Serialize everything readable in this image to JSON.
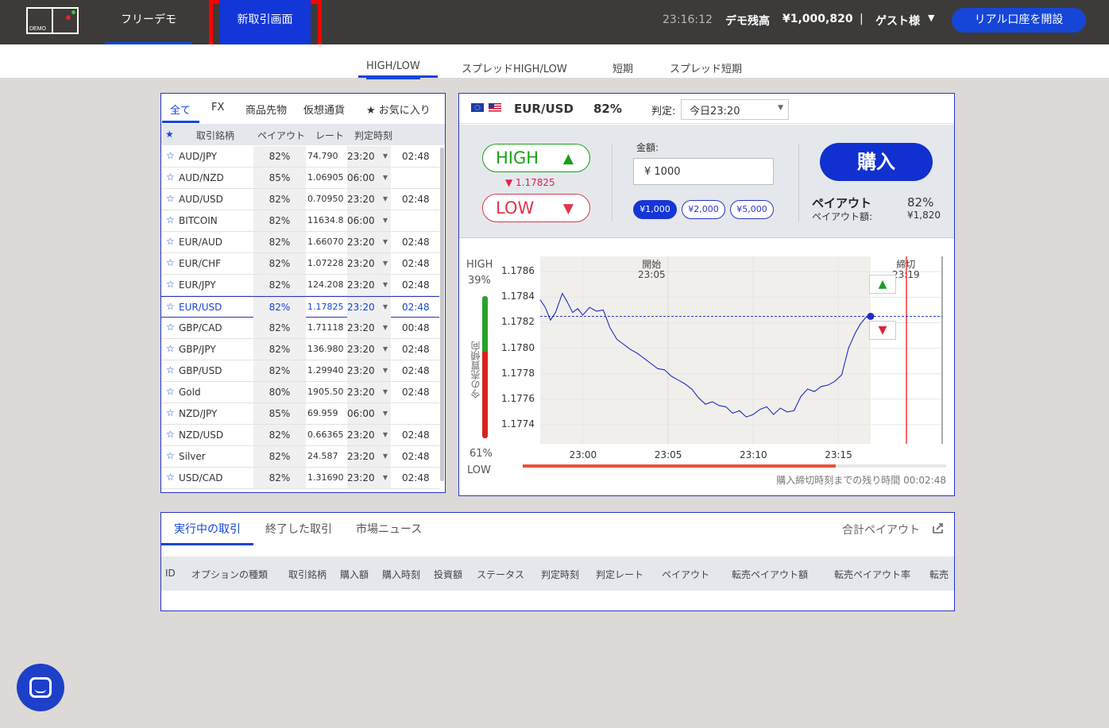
{
  "header": {
    "logo_text": "DEMO",
    "nav_free_demo": "フリーデモ",
    "nav_new_trade": "新取引画面",
    "clock": "23:16:12",
    "balance_label": "デモ残高",
    "balance_value": "¥1,000,820",
    "separator": "|",
    "user": "ゲスト様",
    "open_account": "リアル口座を開設"
  },
  "subnav": [
    "HIGH/LOW",
    "スプレッドHIGH/LOW",
    "短期",
    "スプレッド短期"
  ],
  "asset_filters": [
    "全て",
    "FX",
    "商品先物",
    "仮想通貨",
    "★ お気に入り"
  ],
  "asset_columns": {
    "star": "★",
    "name": "取引銘柄",
    "payout": "ペイアウト",
    "rate": "レート",
    "judge_time": "判定時刻"
  },
  "assets": [
    {
      "name": "AUD/JPY",
      "payout": "82%",
      "rate": "74.790",
      "time": "23:20",
      "remain": "02:48"
    },
    {
      "name": "AUD/NZD",
      "payout": "85%",
      "rate": "1.06905",
      "time": "06:00",
      "remain": ""
    },
    {
      "name": "AUD/USD",
      "payout": "82%",
      "rate": "0.70950",
      "time": "23:20",
      "remain": "02:48"
    },
    {
      "name": "BITCOIN",
      "payout": "82%",
      "rate": "11634.8",
      "time": "06:00",
      "remain": ""
    },
    {
      "name": "EUR/AUD",
      "payout": "82%",
      "rate": "1.66070",
      "time": "23:20",
      "remain": "02:48"
    },
    {
      "name": "EUR/CHF",
      "payout": "82%",
      "rate": "1.07228",
      "time": "23:20",
      "remain": "02:48"
    },
    {
      "name": "EUR/JPY",
      "payout": "82%",
      "rate": "124.208",
      "time": "23:20",
      "remain": "02:48"
    },
    {
      "name": "EUR/USD",
      "payout": "82%",
      "rate": "1.17825",
      "time": "23:20",
      "remain": "02:48"
    },
    {
      "name": "GBP/CAD",
      "payout": "82%",
      "rate": "1.71118",
      "time": "23:20",
      "remain": "00:48"
    },
    {
      "name": "GBP/JPY",
      "payout": "82%",
      "rate": "136.980",
      "time": "23:20",
      "remain": "02:48"
    },
    {
      "name": "GBP/USD",
      "payout": "82%",
      "rate": "1.29940",
      "time": "23:20",
      "remain": "02:48"
    },
    {
      "name": "Gold",
      "payout": "80%",
      "rate": "1905.50",
      "time": "23:20",
      "remain": "02:48"
    },
    {
      "name": "NZD/JPY",
      "payout": "85%",
      "rate": "69.959",
      "time": "06:00",
      "remain": ""
    },
    {
      "name": "NZD/USD",
      "payout": "82%",
      "rate": "0.66365",
      "time": "23:20",
      "remain": "02:48"
    },
    {
      "name": "Silver",
      "payout": "82%",
      "rate": "24.587",
      "time": "23:20",
      "remain": "02:48"
    },
    {
      "name": "USD/CAD",
      "payout": "82%",
      "rate": "1.31690",
      "time": "23:20",
      "remain": "02:48"
    }
  ],
  "selected_asset_index": 7,
  "trade": {
    "pair": "EUR/USD",
    "payout_pct": "82%",
    "judge_label": "判定:",
    "judge_value": "今日23:20",
    "high_label": "HIGH",
    "high_icon": "▲",
    "low_label": "LOW",
    "low_icon": "▼",
    "current_rate": "▼ 1.17825",
    "amount_label": "金額:",
    "amount_value": "¥ 1000",
    "chips": [
      "¥1,000",
      "¥2,000",
      "¥5,000"
    ],
    "buy_label": "購入",
    "payout_label": "ペイアウト",
    "payout_value": "82%",
    "payout_amount_label": "ペイアウト額:",
    "payout_amount_value": "¥1,820"
  },
  "sentiment": {
    "high_label": "HIGH",
    "high_pct": "39%",
    "low_pct": "61%",
    "low_label": "LOW",
    "caption": "今の売買傾向",
    "high_fraction": 0.39
  },
  "chart_data": {
    "type": "line",
    "y_ticks": [
      "1.1786",
      "1.1784",
      "1.1782",
      "1.1780",
      "1.1778",
      "1.1776",
      "1.1774"
    ],
    "x_ticks": [
      "23:00",
      "23:05",
      "23:10",
      "23:15"
    ],
    "ylim": [
      1.17725,
      1.17872
    ],
    "xlim_minutes": [
      -2.5,
      21.1
    ],
    "start_label": "開始",
    "start_time": "23:05",
    "end_label": "締切",
    "end_time": "23:19",
    "current_rate": 1.17825,
    "series": [
      {
        "x": [
          -2.5,
          -2.2,
          -1.9,
          -1.6,
          -1.2,
          -0.9,
          -0.6,
          -0.3,
          0,
          0.4,
          0.8,
          1.2,
          1.6,
          2,
          2.4,
          2.8,
          3.2,
          3.6,
          4,
          4.4,
          4.8,
          5.2,
          5.6,
          6,
          6.4,
          6.8,
          7.2,
          7.6,
          8,
          8.4,
          8.8,
          9.2,
          9.6,
          10,
          10.4,
          10.8,
          11.2,
          11.6,
          12,
          12.4,
          12.8,
          13.2,
          13.6,
          14,
          14.4,
          14.8,
          15.2,
          15.6,
          16,
          16.3,
          16.6,
          16.9
        ],
        "y": [
          1.17838,
          1.17832,
          1.17822,
          1.17828,
          1.17843,
          1.17836,
          1.17828,
          1.17831,
          1.17826,
          1.17832,
          1.17829,
          1.1783,
          1.17816,
          1.17807,
          1.17803,
          1.17799,
          1.17796,
          1.17792,
          1.17788,
          1.17784,
          1.17783,
          1.17778,
          1.17775,
          1.17772,
          1.17768,
          1.17761,
          1.17756,
          1.17758,
          1.17755,
          1.17754,
          1.17749,
          1.17751,
          1.17746,
          1.17748,
          1.17752,
          1.17754,
          1.17748,
          1.17753,
          1.1775,
          1.17751,
          1.17762,
          1.17768,
          1.17766,
          1.1777,
          1.17771,
          1.17774,
          1.17779,
          1.178,
          1.17812,
          1.17819,
          1.17824,
          1.17825
        ]
      }
    ]
  },
  "countdown": {
    "label": "購入締切時刻までの残り時間 00:02:48",
    "fraction_elapsed": 0.74
  },
  "bottom_tabs": [
    "実行中の取引",
    "終了した取引",
    "市場ニュース"
  ],
  "total_payout_label": "合計ペイアウト",
  "trade_columns": [
    "ID",
    "オプションの種類",
    "取引銘柄",
    "購入額",
    "購入時刻",
    "投資額",
    "ステータス",
    "判定時刻",
    "判定レート",
    "ペイアウト",
    "転売ペイアウト額",
    "転売ペイアウト率",
    "転売"
  ],
  "icons": {
    "chat": "chat-icon",
    "export": "export-icon",
    "star": "star-icon"
  },
  "colors": {
    "accent": "#1546d8",
    "high": "#1aa01a",
    "low": "#e0344c",
    "topbar": "#3c3b39",
    "highlight_box": "#ff0000"
  }
}
